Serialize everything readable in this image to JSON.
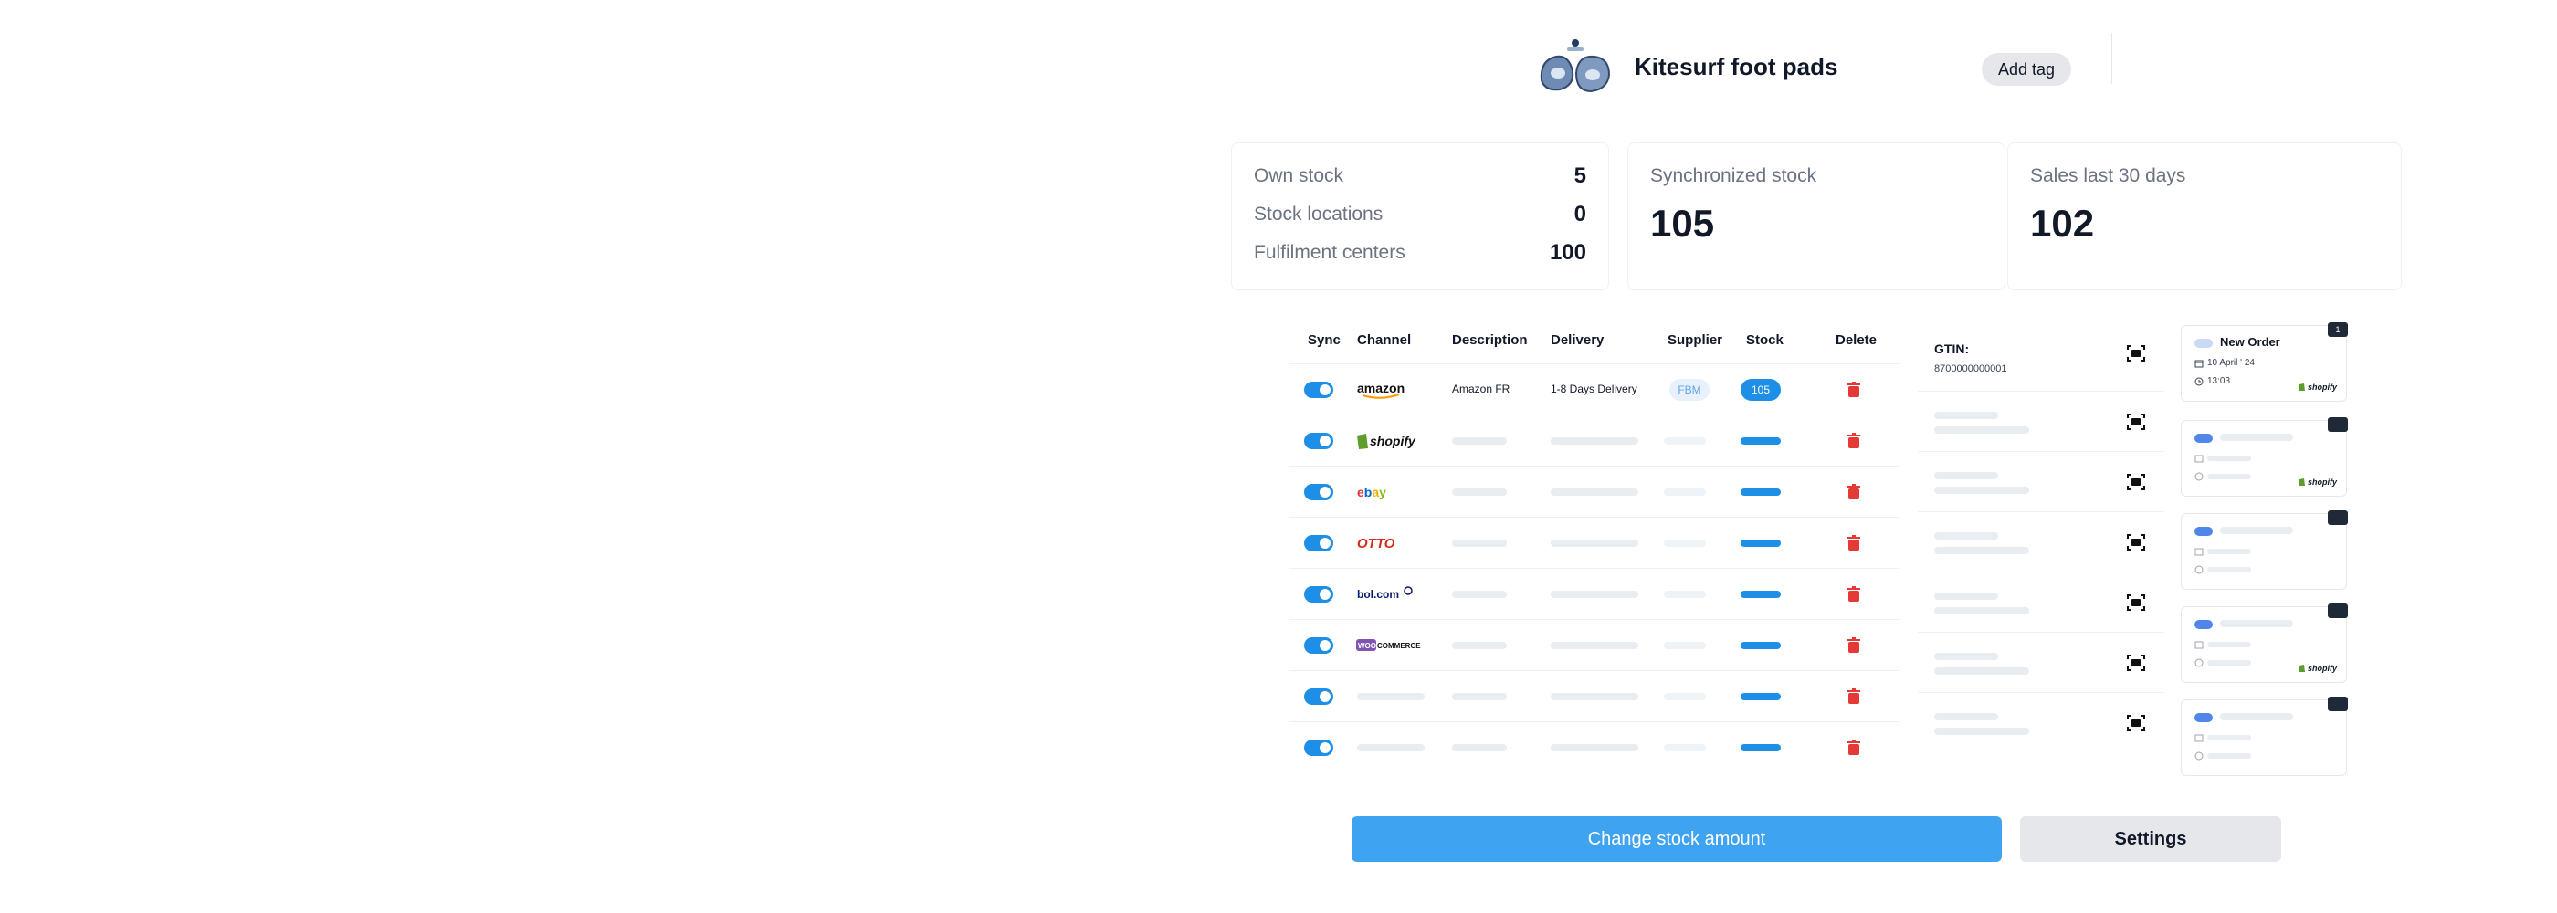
{
  "product": {
    "title": "Kitesurf foot pads",
    "add_tag_label": "Add tag"
  },
  "stats": {
    "own_stock_label": "Own stock",
    "own_stock_value": "5",
    "stock_locations_label": "Stock locations",
    "stock_locations_value": "0",
    "fulfilment_centers_label": "Fulfilment centers",
    "fulfilment_centers_value": "100",
    "synchronized_label": "Synchronized stock",
    "synchronized_value": "105",
    "sales_label": "Sales last 30 days",
    "sales_value": "102"
  },
  "table": {
    "headers": {
      "sync": "Sync",
      "channel": "Channel",
      "description": "Description",
      "delivery": "Delivery",
      "supplier": "Supplier",
      "stock": "Stock",
      "delete": "Delete"
    },
    "first_row": {
      "description": "Amazon FR",
      "delivery": "1-8 Days Delivery",
      "supplier": "FBM",
      "stock": "105"
    },
    "channels": [
      "amazon",
      "shopify",
      "ebay",
      "OTTO",
      "bol.com",
      "WOOCOMMERCE",
      "",
      ""
    ]
  },
  "gtin": {
    "label": "GTIN:",
    "value": "8700000000001"
  },
  "orders": {
    "title": "New Order",
    "date": "10 April ' 24",
    "time": "13:03",
    "badge": "1",
    "shopify_label": "shopify"
  },
  "colors": {
    "accent": "#1d8fe6",
    "primary_button": "#3ea3f0",
    "delete_red": "#e53935"
  },
  "buttons": {
    "change_stock": "Change stock amount",
    "settings": "Settings"
  }
}
